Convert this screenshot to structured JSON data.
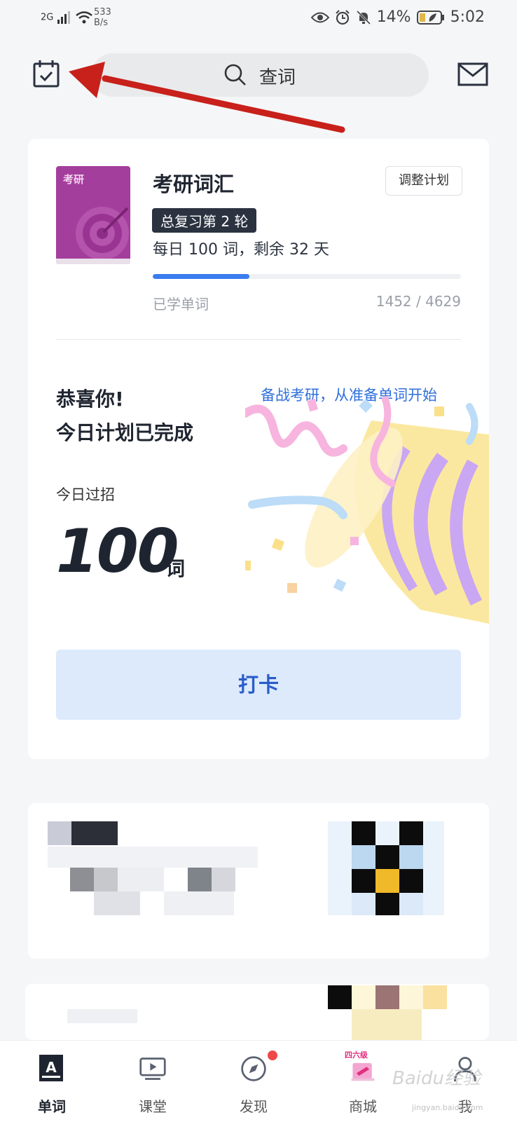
{
  "status_bar": {
    "network": "2G",
    "speed_value": "533",
    "speed_unit": "B/s",
    "battery": "14%",
    "time": "5:02"
  },
  "header": {
    "search_placeholder": "查词"
  },
  "plan": {
    "book_tag": "考研",
    "book_title": "考研词汇",
    "adjust_label": "调整计划",
    "round_badge": "总复习第 2 轮",
    "daily_info": "每日 100 词，剩余 32 天",
    "learned_label": "已学单词",
    "learned_count": "1452 / 4629",
    "progress": 0.314
  },
  "today": {
    "congrats_line1": "恭喜你!",
    "congrats_line2": "今日计划已完成",
    "slogan": "备战考研，从准备单词开始",
    "label": "今日过招",
    "count": "100",
    "unit": "词",
    "checkin_label": "打卡"
  },
  "tabs": [
    {
      "label": "单词",
      "icon": "word-icon",
      "active": true
    },
    {
      "label": "课堂",
      "icon": "classroom-icon",
      "active": false
    },
    {
      "label": "发现",
      "icon": "compass-icon",
      "active": false
    },
    {
      "label": "商城",
      "icon": "shop-icon",
      "badge_text": "四六级",
      "active": false
    },
    {
      "label": "我",
      "icon": "profile-icon",
      "active": false
    }
  ],
  "colors": {
    "accent": "#3b7cf0",
    "book": "#a43e9d",
    "checkin_bg": "#dceafc",
    "annotation_arrow": "#c8201a"
  },
  "watermark": {
    "text": "Baidu经验",
    "url": "jingyan.baidu.com"
  }
}
